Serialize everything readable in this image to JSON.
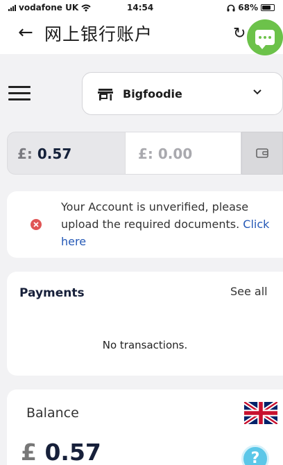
{
  "status_bar": {
    "carrier": "vodafone UK",
    "time": "14:54",
    "battery": "68%"
  },
  "nav": {
    "title": "网上银行账户",
    "back_icon": "arrow-left-icon",
    "refresh_icon": "refresh-icon",
    "chat_icon": "chat-bubble-icon"
  },
  "merchant": {
    "name": "Bigfoodie",
    "store_icon": "store-icon",
    "dropdown_icon": "chevron-down-icon"
  },
  "balances": {
    "main_currency": "£:",
    "main_value": "0.57",
    "secondary_currency": "£:",
    "secondary_value": "0.00",
    "wallet_icon": "wallet-icon"
  },
  "alert": {
    "message": "Your Account is unverified, please upload the required documents.",
    "link_text": "Click here"
  },
  "payments": {
    "title": "Payments",
    "see_all": "See all",
    "empty_text": "No transactions."
  },
  "balance_card": {
    "title": "Balance",
    "currency": "£",
    "amount": "0.57"
  },
  "colors": {
    "chat_green": "#6cc24a",
    "error_red": "#e05555",
    "link_blue": "#2458b6",
    "help_blue": "#5cc7e8"
  }
}
